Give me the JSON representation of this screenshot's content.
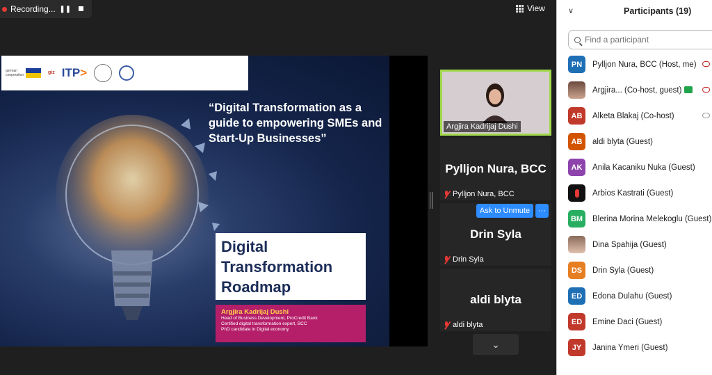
{
  "recording": {
    "label": "Recording..."
  },
  "view": {
    "label": "View"
  },
  "slide": {
    "quote": "“Digital Transformation as a guide to empowering SMEs and Start-Up Businesses”",
    "roadmap": [
      "Digital",
      "Transformation",
      "Roadmap"
    ],
    "presenter_name": "Argjira Kadrijaj Dushi",
    "presenter_lines": [
      "Head of Business Development, ProCredit Bank",
      "Certified digital transformation expert, BCC",
      "PhD candidate in Digital economy"
    ],
    "logos": {
      "german": "german cooperation",
      "itp": "ITP"
    }
  },
  "tiles": {
    "camera_caption": "Argjira Kadrijaj Dushi",
    "pyllion_big": "Pylljon Nura, BCC",
    "pyllion_small": "Pylljon Nura, BCC",
    "drin_big": "Drin Syla",
    "drin_small": "Drin Syla",
    "aldi_big": "aldi blyta",
    "aldi_small": "aldi blyta",
    "ask_unmute": "Ask to Unmute",
    "more": "···"
  },
  "panel": {
    "title": "Participants (19)",
    "search_placeholder": "Find a participant",
    "participants": [
      {
        "initials": "PN",
        "name": "Pylljon Nura, BCC (Host, me)",
        "color": "#1f6fb5"
      },
      {
        "initials": "",
        "name": "Argjira... (Co-host, guest)",
        "color": "#b08070"
      },
      {
        "initials": "AB",
        "name": "Alketa Blakaj (Co-host)",
        "color": "#c0392b"
      },
      {
        "initials": "AB",
        "name": "aldi blyta (Guest)",
        "color": "#d35400"
      },
      {
        "initials": "AK",
        "name": "Anila Kacaniku Nuka (Guest)",
        "color": "#8e44ad"
      },
      {
        "initials": "",
        "name": "Arbios Kastrati (Guest)",
        "color": "#111111"
      },
      {
        "initials": "BM",
        "name": "Blerina Morina Melekoglu (Guest)",
        "color": "#27ae60"
      },
      {
        "initials": "",
        "name": "Dina Spahija (Guest)",
        "color": "#c49a88"
      },
      {
        "initials": "DS",
        "name": "Drin Syla (Guest)",
        "color": "#e67e22"
      },
      {
        "initials": "ED",
        "name": "Edona Dulahu (Guest)",
        "color": "#1f6fb5"
      },
      {
        "initials": "ED",
        "name": "Emine Daci (Guest)",
        "color": "#c0392b"
      },
      {
        "initials": "JY",
        "name": "Janina Ymeri (Guest)",
        "color": "#c0392b"
      }
    ]
  }
}
